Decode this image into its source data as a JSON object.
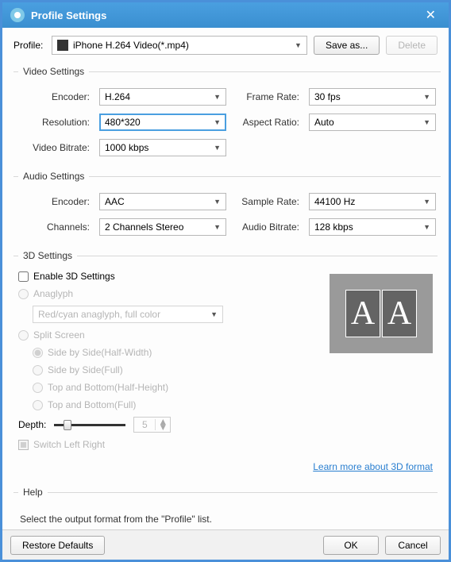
{
  "window": {
    "title": "Profile Settings"
  },
  "profile": {
    "label": "Profile:",
    "value": "iPhone H.264 Video(*.mp4)",
    "save_as": "Save as...",
    "delete": "Delete"
  },
  "sections": {
    "video": {
      "legend": "Video Settings",
      "encoder_label": "Encoder:",
      "encoder": "H.264",
      "framerate_label": "Frame Rate:",
      "framerate": "30 fps",
      "resolution_label": "Resolution:",
      "resolution": "480*320",
      "aspect_label": "Aspect Ratio:",
      "aspect": "Auto",
      "bitrate_label": "Video Bitrate:",
      "bitrate": "1000 kbps"
    },
    "audio": {
      "legend": "Audio Settings",
      "encoder_label": "Encoder:",
      "encoder": "AAC",
      "samplerate_label": "Sample Rate:",
      "samplerate": "44100 Hz",
      "channels_label": "Channels:",
      "channels": "2 Channels Stereo",
      "bitrate_label": "Audio Bitrate:",
      "bitrate": "128 kbps"
    },
    "threed": {
      "legend": "3D Settings",
      "enable": "Enable 3D Settings",
      "anaglyph": "Anaglyph",
      "anaglyph_mode": "Red/cyan anaglyph, full color",
      "split_screen": "Split Screen",
      "opts": {
        "sbs_half": "Side by Side(Half-Width)",
        "sbs_full": "Side by Side(Full)",
        "tb_half": "Top and Bottom(Half-Height)",
        "tb_full": "Top and Bottom(Full)"
      },
      "depth_label": "Depth:",
      "depth_value": "5",
      "switch_lr": "Switch Left Right",
      "preview_glyph": "A",
      "learn_more": "Learn more about 3D format"
    },
    "help": {
      "legend": "Help",
      "text": "Select the output format from the \"Profile\" list."
    }
  },
  "footer": {
    "restore": "Restore Defaults",
    "ok": "OK",
    "cancel": "Cancel"
  }
}
